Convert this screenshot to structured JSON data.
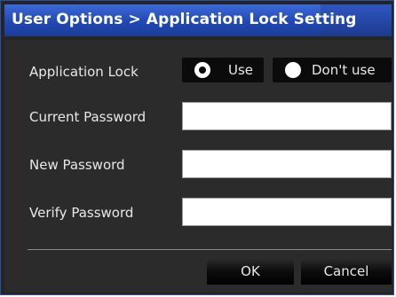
{
  "dialog": {
    "title": "User Options > Application Lock Setting"
  },
  "form": {
    "application_lock_label": "Application Lock",
    "lock_options": {
      "use_label": "Use",
      "dont_use_label": "Don't use",
      "selected": "Use"
    },
    "current_password_label": "Current Password",
    "current_password_value": "",
    "new_password_label": "New Password",
    "new_password_value": "",
    "verify_password_label": "Verify Password",
    "verify_password_value": ""
  },
  "buttons": {
    "ok_label": "OK",
    "cancel_label": "Cancel"
  },
  "colors": {
    "title_bar": "#2148b3",
    "panel_background": "#2b2b2b",
    "text": "#e8e8e8"
  }
}
